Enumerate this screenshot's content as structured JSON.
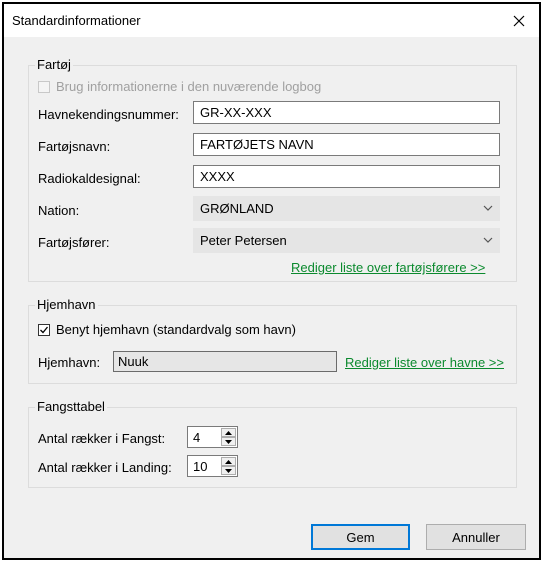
{
  "window": {
    "title": "Standardinformationer"
  },
  "vessel": {
    "group_label": "Fartøj",
    "use_current_logbook_label": "Brug informationerne i den nuværende logbog",
    "harbor_id": {
      "label": "Havnekendingsnummer:",
      "value": "GR-XX-XXX"
    },
    "vessel_name": {
      "label": "Fartøjsnavn:",
      "value": "FARTØJETS NAVN"
    },
    "radio_call_sign": {
      "label": "Radiokaldesignal:",
      "value": "XXXX"
    },
    "nation": {
      "label": "Nation:",
      "selected": "GRØNLAND"
    },
    "skipper": {
      "label": "Fartøjsfører:",
      "selected": "Peter Petersen"
    },
    "edit_skippers_link": "Rediger liste over fartøjsførere >>"
  },
  "home_harbor": {
    "group_label": "Hjemhavn",
    "use_home_harbor_label": "Benyt hjemhavn (standardvalg som havn)",
    "use_home_harbor_checked": true,
    "harbor": {
      "label": "Hjemhavn:",
      "value": "Nuuk"
    },
    "edit_harbors_link": "Rediger liste over havne >>"
  },
  "catch_table": {
    "group_label": "Fangsttabel",
    "rows_catch": {
      "label": "Antal rækker i Fangst:",
      "value": "4"
    },
    "rows_landing": {
      "label": "Antal rækker i Landing:",
      "value": "10"
    }
  },
  "buttons": {
    "save": "Gem",
    "cancel": "Annuller"
  },
  "colors": {
    "link": "#0b8a2e",
    "primary_border": "#0078d7",
    "dialog_bg": "#f0f0f0"
  }
}
